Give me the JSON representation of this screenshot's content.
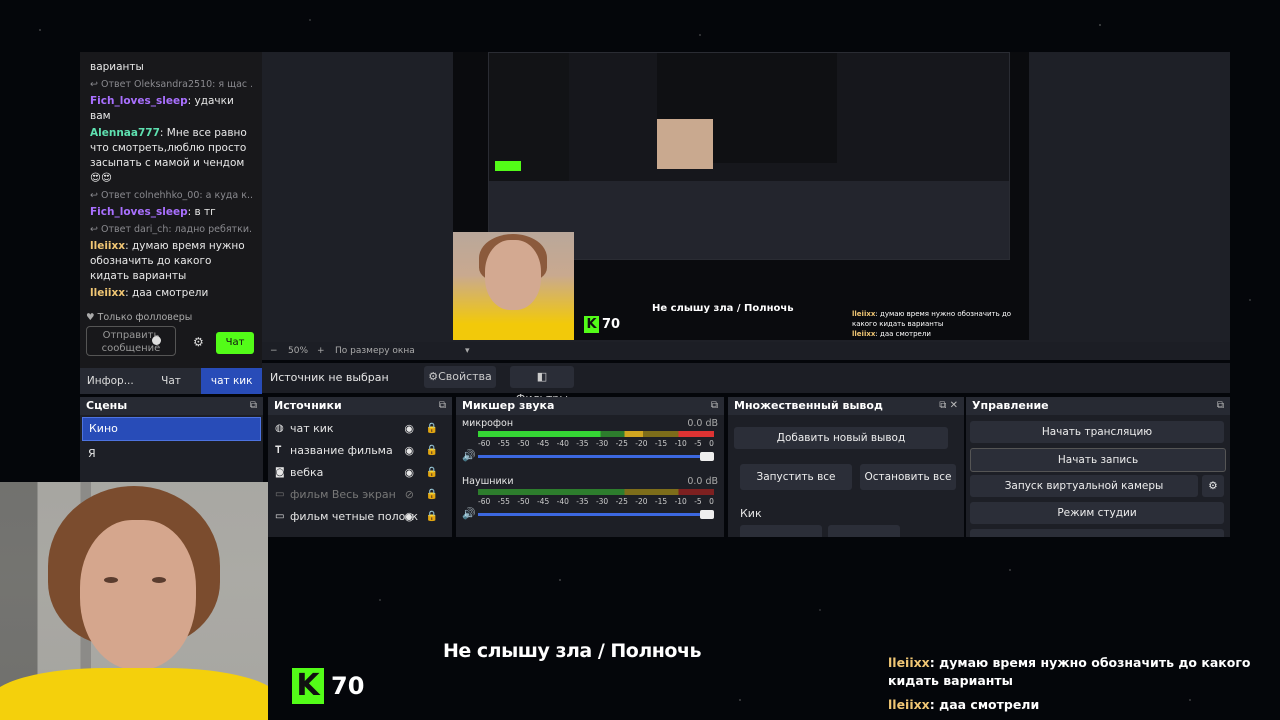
{
  "chat": {
    "messages": [
      {
        "type": "msg",
        "text": "варианты"
      },
      {
        "type": "reply",
        "text": "Ответ Oleksandra2510: я щас ..."
      },
      {
        "type": "msg",
        "user": "Fich_loves_sleep",
        "color": "#a970ff",
        "text": "удачки вам"
      },
      {
        "type": "msg",
        "user": "Alennaa777",
        "color": "#5ee0b0",
        "text": "Мне все равно что смотреть,люблю просто засыпать с мамой и чендом 😍😍"
      },
      {
        "type": "reply",
        "text": "Ответ colnehhko_00: а куда к..."
      },
      {
        "type": "msg",
        "user": "Fich_loves_sleep",
        "color": "#a970ff",
        "text": "в тг"
      },
      {
        "type": "reply",
        "text": "Ответ dari_ch: ладно ребятки..."
      },
      {
        "type": "msg",
        "user": "lleiixx",
        "color": "#f0c674",
        "text": "думаю время нужно обозначить до какого кидать варианты"
      },
      {
        "type": "msg",
        "user": "lleiixx",
        "color": "#f0c674",
        "text": "даа смотрели"
      }
    ],
    "followers_only": "Только фолловеры",
    "send_placeholder": "Отправить сообщение",
    "chat_button": "Чат",
    "tabs": [
      "Инфор...",
      "Чат",
      "чат кик"
    ]
  },
  "preview": {
    "zoom": "50%",
    "fit": "По размеру окна",
    "kick_count": "70",
    "overlay_title": "Не слышу зла / Полночь",
    "overlay_chat": [
      {
        "user": "lleiixx",
        "text": "думаю время нужно обозначить до какого кидать варианты"
      },
      {
        "user": "lleiixx",
        "text": "даа смотрели"
      }
    ]
  },
  "source_bar": {
    "status": "Источник не выбран",
    "properties": "Свойства",
    "filters": "Фильтры"
  },
  "scenes": {
    "title": "Сцены",
    "items": [
      "Кино",
      "Я"
    ]
  },
  "sources": {
    "title": "Источники",
    "items": [
      {
        "name": "чат кик",
        "icon": "globe-icon",
        "visible": true
      },
      {
        "name": "название фильма",
        "icon": "text-icon",
        "visible": true
      },
      {
        "name": "вебка",
        "icon": "camera-icon",
        "visible": true
      },
      {
        "name": "фильм Весь экран",
        "icon": "window-icon",
        "visible": false
      },
      {
        "name": "фильм четные полоск",
        "icon": "window-icon",
        "visible": true
      }
    ]
  },
  "mixer": {
    "title": "Микшер звука",
    "channels": [
      {
        "name": "микрофон",
        "db": "0.0 dB"
      },
      {
        "name": "Наушники",
        "db": "0.0 dB"
      }
    ],
    "scale": [
      "-60",
      "-55",
      "-50",
      "-45",
      "-40",
      "-35",
      "-30",
      "-25",
      "-20",
      "-15",
      "-10",
      "-5",
      "0"
    ]
  },
  "multi_output": {
    "title": "Множественный вывод",
    "add": "Добавить новый вывод",
    "start_all": "Запустить все",
    "stop_all": "Остановить все",
    "target": "Кик"
  },
  "controls": {
    "title": "Управление",
    "buttons": [
      "Начать трансляцию",
      "Начать запись",
      "Запуск виртуальной камеры",
      "Режим студии"
    ]
  },
  "stream_overlay": {
    "title": "Не слышу зла / Полночь",
    "kick_count": "70",
    "kick_logo": "K",
    "chat": [
      {
        "user": "lleiixx",
        "text": "думаю время нужно обозначить до какого кидать варианты"
      },
      {
        "user": "lleiixx",
        "text": "даа смотрели"
      }
    ]
  },
  "colors": {
    "kick_green": "#53fc18",
    "selection_blue": "#284cb8",
    "chat_user_yellow": "#f0c674"
  }
}
